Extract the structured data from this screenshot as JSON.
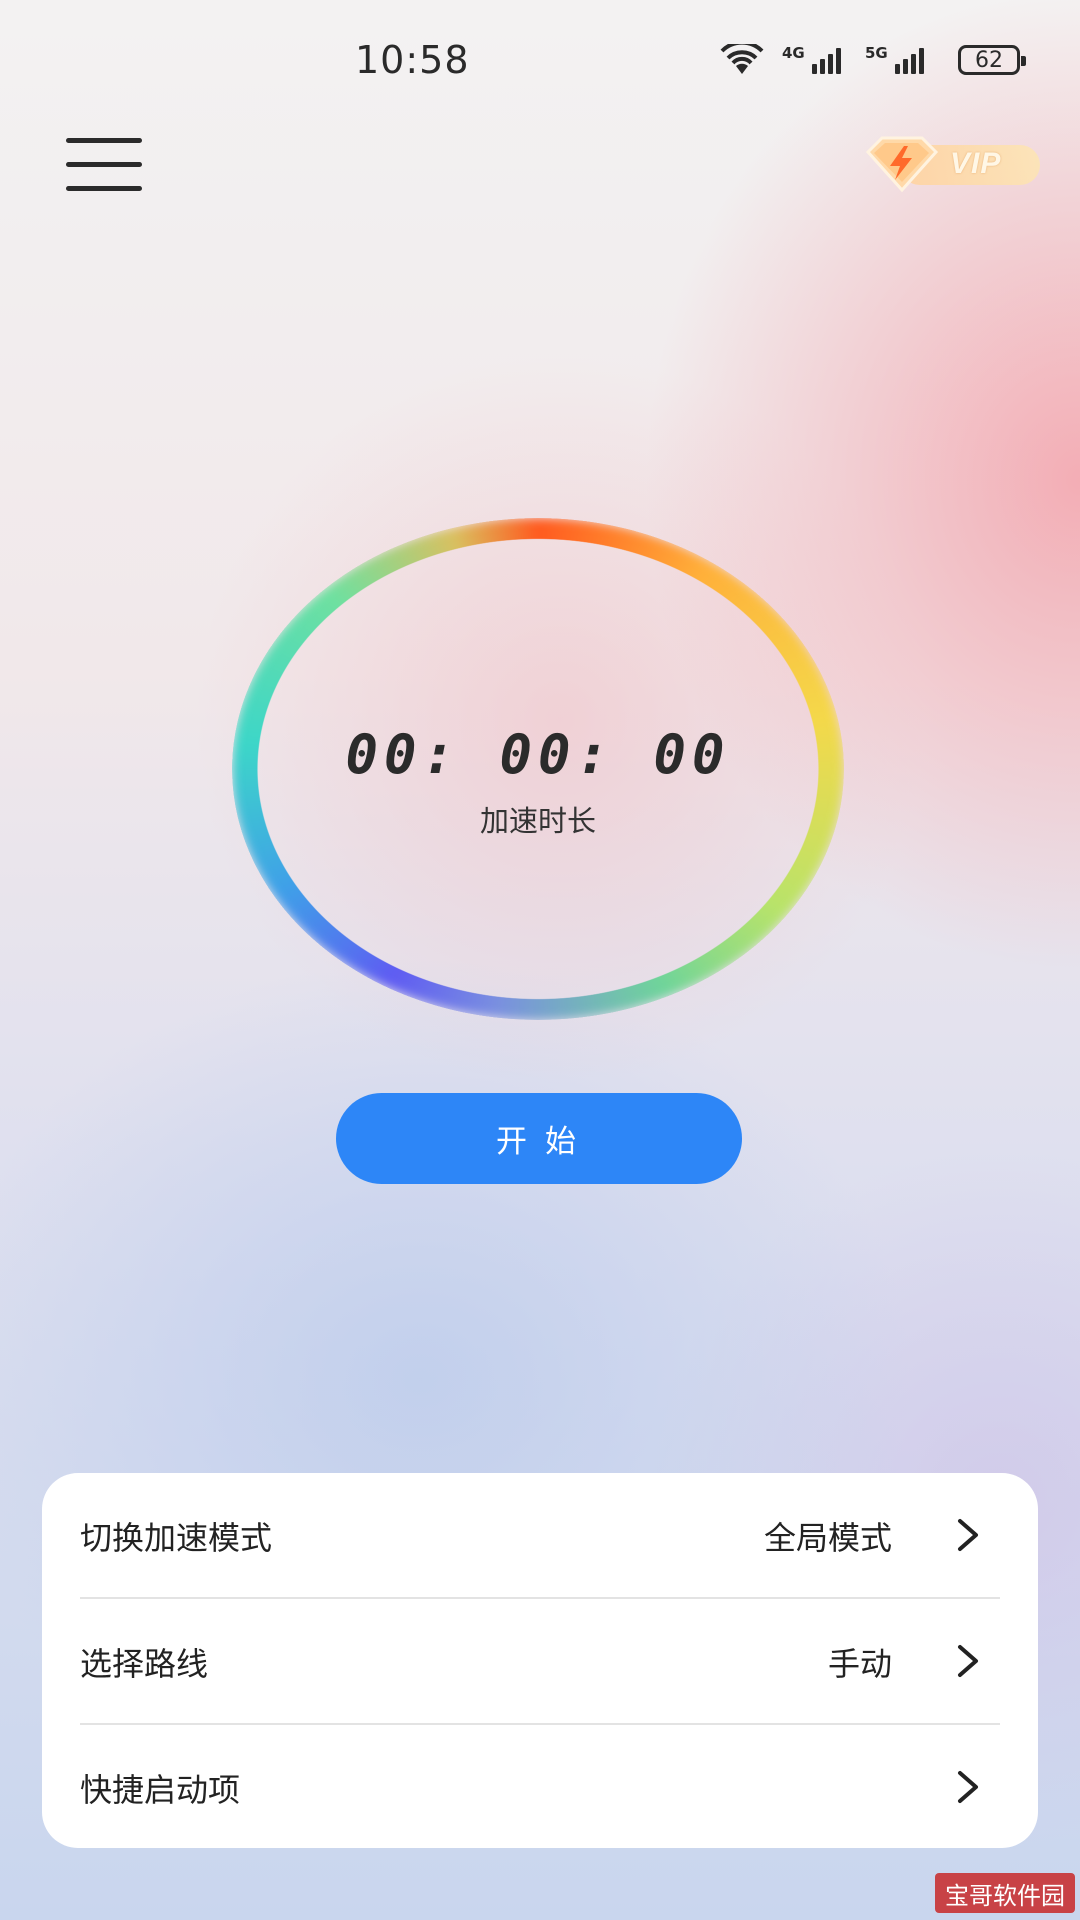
{
  "status_bar": {
    "time": "10:58",
    "network_1": "4G",
    "network_2": "5G",
    "battery": "62"
  },
  "header": {
    "vip_label": "VIP"
  },
  "timer": {
    "value": "00: 00: 00",
    "label": "加速时长"
  },
  "start_button": {
    "label": "开始"
  },
  "settings": {
    "rows": [
      {
        "label": "切换加速模式",
        "value": "全局模式"
      },
      {
        "label": "选择路线",
        "value": "手动"
      },
      {
        "label": "快捷启动项",
        "value": ""
      }
    ]
  },
  "watermark": {
    "text": "宝哥软件园"
  },
  "colors": {
    "accent": "#2d86f7",
    "card": "#ffffff",
    "text": "#222222"
  },
  "icons": {
    "menu": "hamburger-menu-icon",
    "vip": "lightning-diamond-icon",
    "chevron": "chevron-right-icon"
  }
}
